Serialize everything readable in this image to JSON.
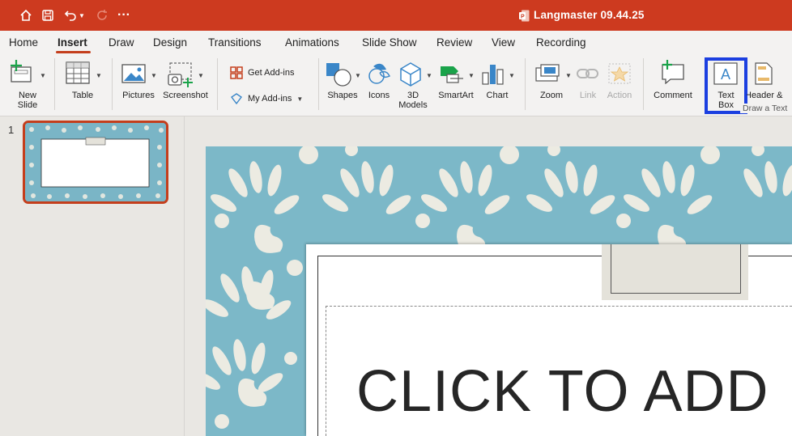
{
  "window": {
    "title": "Langmaster 09.44.25"
  },
  "quick_access": [
    {
      "name": "home-icon"
    },
    {
      "name": "save-icon"
    },
    {
      "name": "undo-icon"
    },
    {
      "name": "redo-icon"
    },
    {
      "name": "more-icon",
      "glyph": "···"
    }
  ],
  "tabs": [
    {
      "label": "Home"
    },
    {
      "label": "Insert",
      "active": true
    },
    {
      "label": "Draw"
    },
    {
      "label": "Design"
    },
    {
      "label": "Transitions"
    },
    {
      "label": "Animations"
    },
    {
      "label": "Slide Show"
    },
    {
      "label": "Review"
    },
    {
      "label": "View"
    },
    {
      "label": "Recording"
    }
  ],
  "ribbon": {
    "new_slide": "New\nSlide",
    "table": "Table",
    "pictures": "Pictures",
    "screenshot": "Screenshot",
    "get_addins": "Get Add-ins",
    "my_addins": "My Add-ins",
    "shapes": "Shapes",
    "icons": "Icons",
    "models_3d": "3D\nModels",
    "smartart": "SmartArt",
    "chart": "Chart",
    "zoom": "Zoom",
    "link": "Link",
    "action": "Action",
    "comment": "Comment",
    "text_box": "Text\nBox",
    "header_footer": "Header &",
    "tooltip": "Draw a Text"
  },
  "thumbnails": [
    {
      "number": "1"
    }
  ],
  "slide": {
    "title_placeholder": "CLICK TO ADD"
  },
  "colors": {
    "titlebar": "#cd3a1f",
    "accent": "#c43e1c",
    "highlight": "#1b3fe0",
    "slide_bg": "#7cb8c8",
    "leaf": "#ecebe2"
  }
}
